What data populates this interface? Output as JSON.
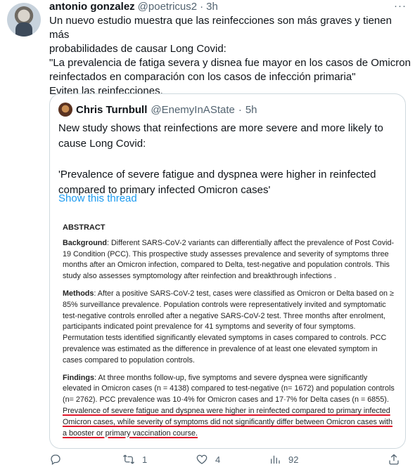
{
  "tweet": {
    "name": "antonio gonzalez",
    "handle": "@poetricus2",
    "dot": "·",
    "time": "3h",
    "more": "···",
    "lines": [
      "Un nuevo estudio muestra que las reinfecciones son más graves y tienen más",
      "probabilidades de causar Long Covid:",
      "\"La prevalencia de fatiga severa y disnea fue mayor en los casos de Omicron",
      "reinfectados en comparación con los casos de infección primaria\"",
      "Eviten las reinfecciones."
    ]
  },
  "quote": {
    "name": "Chris Turnbull",
    "handle": "@EnemyInAState",
    "dot": "·",
    "time": "5h",
    "line1": "New study shows that reinfections are more severe and more likely to",
    "line2": "cause  Long Covid:",
    "line3": "'Prevalence of severe fatigue and dyspnea were higher in reinfected",
    "line4": "compared to primary infected Omicron cases'",
    "show_thread": "Show this thread"
  },
  "abstract": {
    "title": "ABSTRACT",
    "background_label": "Background",
    "background_text": ": Different SARS-CoV-2 variants can differentially affect the prevalence of Post Covid-19 Condition (PCC). This prospective study assesses prevalence and severity of symptoms three months after an Omicron infection, compared to Delta, test-negative and population controls. This study also assesses symptomology after reinfection and breakthrough infections .",
    "methods_label": "Methods",
    "methods_text": ": After a positive SARS-CoV-2 test, cases were classified as Omicron or Delta based on ≥ 85% surveillance prevalence. Population controls were representatively invited and symptomatic test-negative controls enrolled after a negative SARS-CoV-2 test. Three months after enrolment, participants indicated point prevalence for 41 symptoms and severity of four symptoms. Permutation tests identified significantly elevated symptoms in cases compared to controls. PCC prevalence was estimated as the difference in prevalence of at least one elevated symptom in cases compared to population controls.",
    "findings_label": "Findings",
    "findings_text": ": At three months follow-up, five symptoms and severe dyspnea were significantly elevated in Omicron cases (n = 4138) compared to test-negative (n= 1672) and population controls (n= 2762). PCC prevalence was 10·4% for Omicron cases and 17·7% for Delta cases (n = 6855). ",
    "findings_highlight": "Prevalence of severe fatigue and dyspnea were higher in reinfected compared to primary infected Omicron cases, while severity of symptoms did not significantly differ between Omicron cases with a booster or primary vaccination course."
  },
  "actions": {
    "reply_count": "",
    "retweet_count": "1",
    "like_count": "4",
    "views_count": "92"
  },
  "icons": [
    "reply-icon",
    "retweet-icon",
    "like-icon",
    "analytics-icon",
    "share-icon"
  ],
  "colors": {
    "link": "#1d9bf0",
    "muted": "#536471",
    "underline": "#e0182c"
  }
}
